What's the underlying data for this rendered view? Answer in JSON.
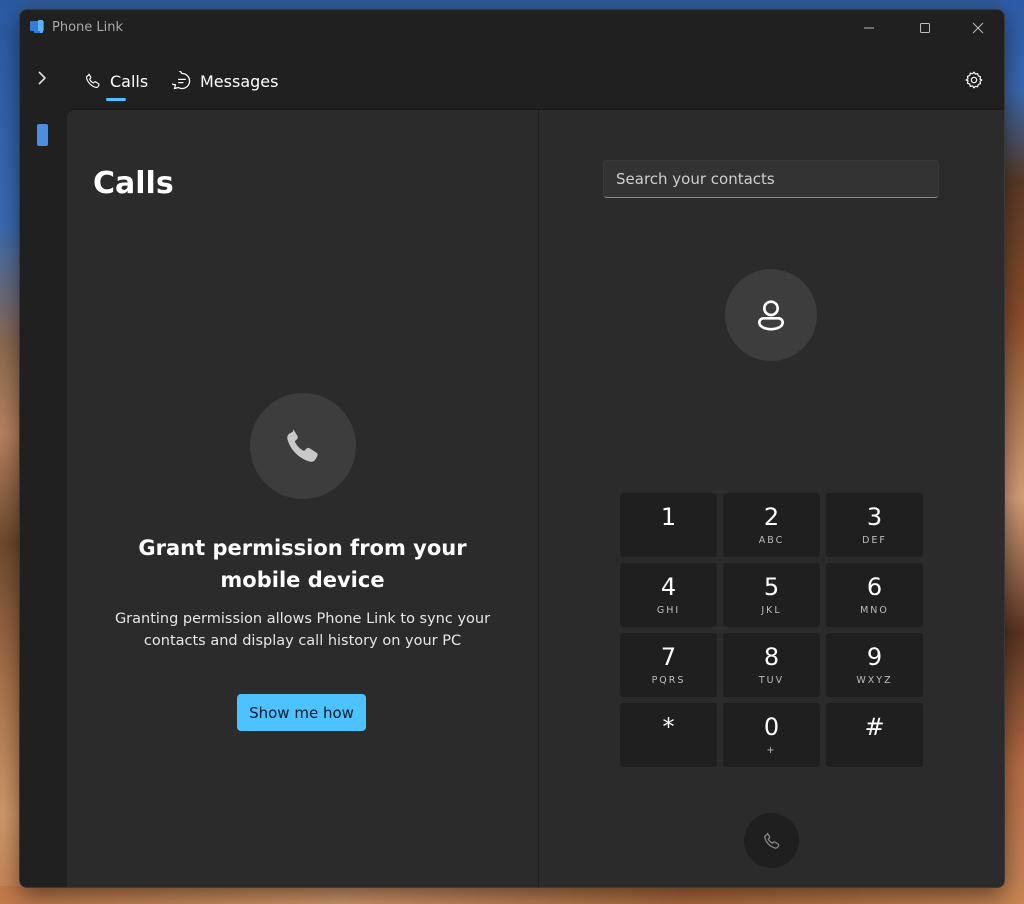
{
  "window": {
    "title": "Phone Link"
  },
  "nav": {
    "tabs": [
      {
        "label": "Calls",
        "icon": "phone-icon",
        "selected": true
      },
      {
        "label": "Messages",
        "icon": "chat-icon",
        "selected": false
      }
    ],
    "settings_icon": "gear-icon"
  },
  "calls": {
    "title": "Calls",
    "permission_title": "Grant permission from your mobile device",
    "permission_desc": "Granting permission allows Phone Link to sync your contacts and display call history on your PC",
    "show_button": "Show me how"
  },
  "dialer": {
    "search_placeholder": "Search your contacts",
    "keys": [
      {
        "digit": "1",
        "letters": ""
      },
      {
        "digit": "2",
        "letters": "ABC"
      },
      {
        "digit": "3",
        "letters": "DEF"
      },
      {
        "digit": "4",
        "letters": "GHI"
      },
      {
        "digit": "5",
        "letters": "JKL"
      },
      {
        "digit": "6",
        "letters": "MNO"
      },
      {
        "digit": "7",
        "letters": "PQRS"
      },
      {
        "digit": "8",
        "letters": "TUV"
      },
      {
        "digit": "9",
        "letters": "WXYZ"
      },
      {
        "digit": "*",
        "letters": ""
      },
      {
        "digit": "0",
        "letters": "+"
      },
      {
        "digit": "#",
        "letters": ""
      }
    ]
  },
  "colors": {
    "accent": "#4cc2ff",
    "window_bg": "#202020",
    "content_bg": "#2b2b2b",
    "key_bg": "#1f1f1f"
  }
}
